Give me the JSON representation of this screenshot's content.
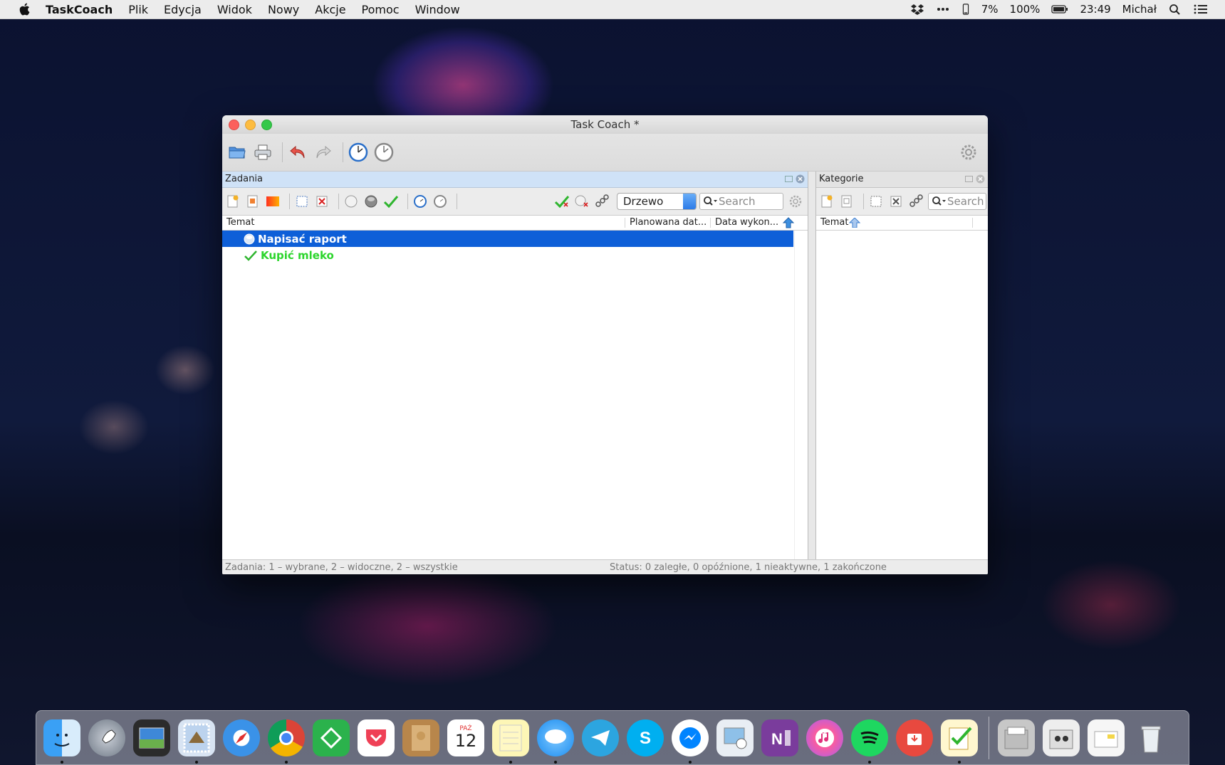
{
  "menubar": {
    "app_name": "TaskCoach",
    "items": [
      "Plik",
      "Edycja",
      "Widok",
      "Nowy",
      "Akcje",
      "Pomoc",
      "Window"
    ],
    "battery_small": "7%",
    "battery": "100%",
    "time": "23:49",
    "user": "Michał"
  },
  "window": {
    "title": "Task Coach *"
  },
  "tasks_pane": {
    "title": "Zadania",
    "view_mode": "Drzewo",
    "search_placeholder": "Search",
    "columns": [
      "Temat",
      "Planowana dat...",
      "Data wykon..."
    ],
    "rows": [
      {
        "subject": "Napisać raport",
        "state": "selected",
        "icon": "active-task-icon"
      },
      {
        "subject": "Kupić mleko",
        "state": "completed",
        "icon": "check-icon"
      }
    ]
  },
  "categories_pane": {
    "title": "Kategorie",
    "search_placeholder": "Search",
    "columns": [
      "Temat"
    ]
  },
  "statusbar": {
    "left": "Zadania: 1 – wybrane, 2 – widoczne, 2 – wszystkie",
    "right": "Status: 0 zaległe, 0 opóźnione, 1 nieaktywne, 1 zakończone"
  },
  "dock": {
    "calendar_month": "PAŹ",
    "calendar_day": "12",
    "apps": [
      "finder",
      "launchpad",
      "photo-viewer",
      "mail-stamp",
      "safari",
      "chrome",
      "feedly",
      "pocket",
      "contacts",
      "calendar",
      "notes",
      "messages",
      "telegram",
      "skype",
      "messenger",
      "preview",
      "onenote",
      "itunes",
      "spotify",
      "downloader",
      "taskcoach",
      "documents",
      "photos-folder",
      "files",
      "trash"
    ]
  }
}
